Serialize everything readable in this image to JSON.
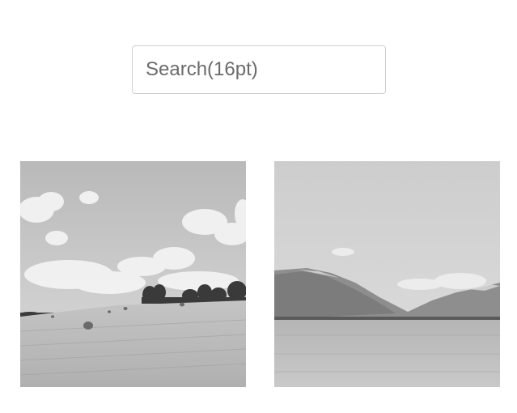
{
  "search": {
    "placeholder": "Search(16pt)",
    "value": ""
  },
  "gallery": {
    "items": [
      {
        "name": "field",
        "icon": "landscape-field-hay-bales"
      },
      {
        "name": "lake",
        "icon": "landscape-lake-mountains"
      }
    ]
  },
  "colors": {
    "background": "#ffffff",
    "input_border": "#cfcfcf",
    "placeholder_text": "#6b6b6b"
  }
}
